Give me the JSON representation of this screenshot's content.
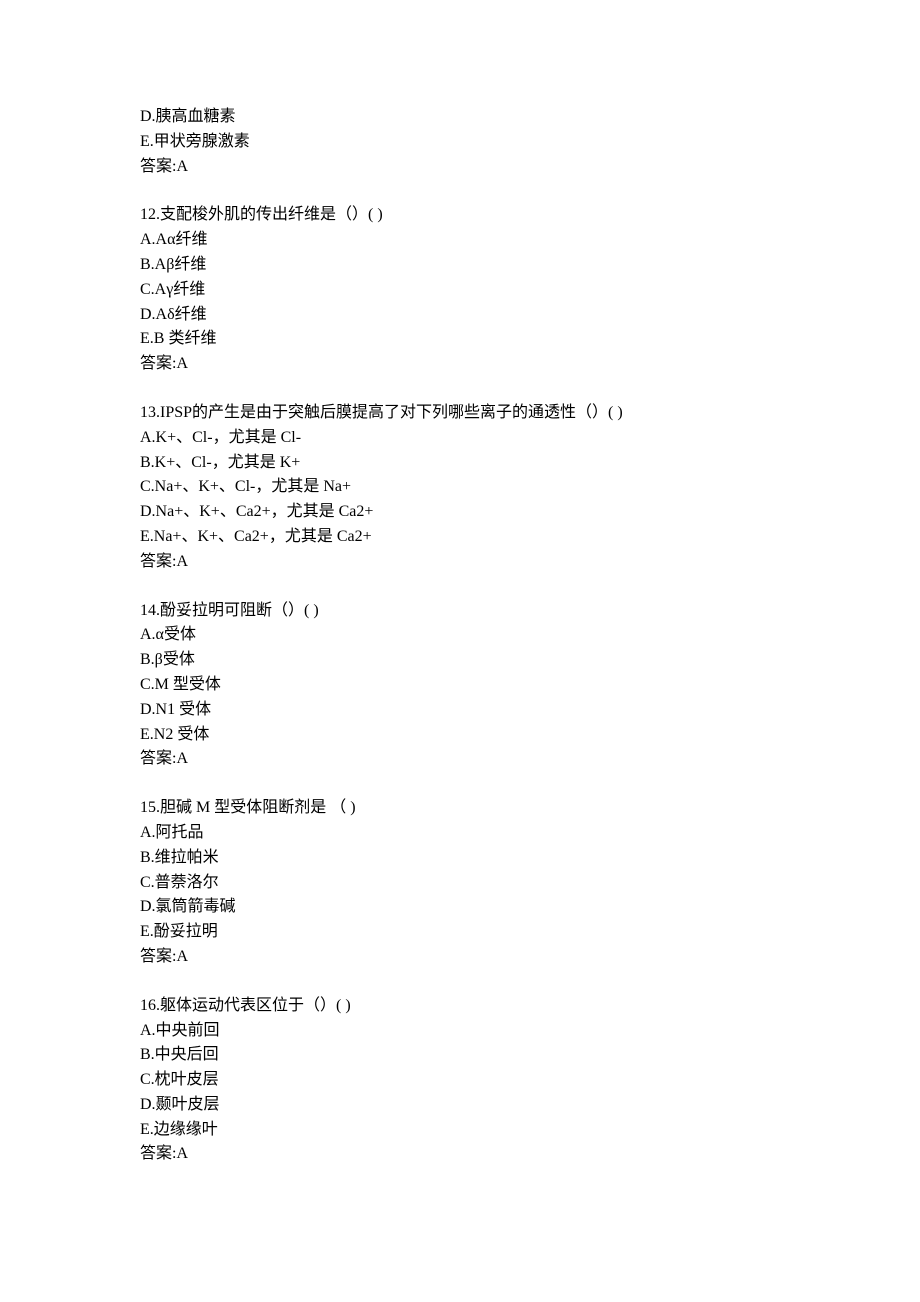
{
  "intro": {
    "lines": [
      "D.胰高血糖素",
      "E.甲状旁腺激素",
      "答案:A"
    ]
  },
  "questions": [
    {
      "number": "12",
      "stem": "支配梭外肌的传出纤维是（）( )",
      "options": [
        "A.Aα纤维",
        "B.Aβ纤维",
        "C.Aγ纤维",
        "D.Aδ纤维",
        "E.B 类纤维"
      ],
      "answer": "答案:A"
    },
    {
      "number": "13",
      "stem": "IPSP的产生是由于突触后膜提高了对下列哪些离子的通透性（）( )",
      "options": [
        "A.K+、Cl-，尤其是 Cl-",
        "B.K+、Cl-，尤其是 K+",
        "C.Na+、K+、Cl-，尤其是 Na+",
        "D.Na+、K+、Ca2+，尤其是 Ca2+",
        "E.Na+、K+、Ca2+，尤其是 Ca2+"
      ],
      "answer": "答案:A"
    },
    {
      "number": "14",
      "stem": "酚妥拉明可阻断（）( )",
      "options": [
        "A.α受体",
        "B.β受体",
        "C.M 型受体",
        "D.N1 受体",
        "E.N2 受体"
      ],
      "answer": "答案:A"
    },
    {
      "number": "15",
      "stem": "胆碱 M 型受体阻断剂是 （ )",
      "options": [
        "A.阿托品",
        "B.维拉帕米",
        "C.普萘洛尔",
        "D.氯筒箭毒碱",
        "E.酚妥拉明"
      ],
      "answer": "答案:A"
    },
    {
      "number": "16",
      "stem": "躯体运动代表区位于（）( )",
      "options": [
        "A.中央前回",
        "B.中央后回",
        "C.枕叶皮层",
        "D.颞叶皮层",
        "E.边缘缘叶"
      ],
      "answer": "答案:A"
    }
  ]
}
